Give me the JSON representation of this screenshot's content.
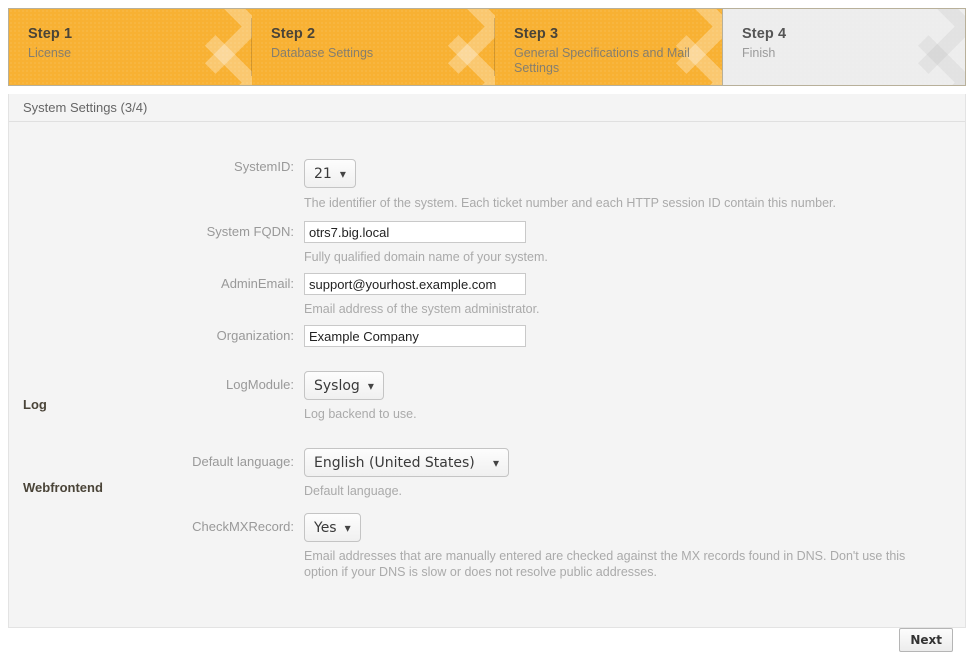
{
  "wizard": {
    "steps": [
      {
        "title": "Step 1",
        "subtitle": "License",
        "state": "done"
      },
      {
        "title": "Step 2",
        "subtitle": "Database Settings",
        "state": "done"
      },
      {
        "title": "Step 3",
        "subtitle": "General Specifications and Mail Settings",
        "state": "active"
      },
      {
        "title": "Step 4",
        "subtitle": "Finish",
        "state": "inactive"
      }
    ],
    "active_color": "#f8b133",
    "inactive_color": "#ededed"
  },
  "panel": {
    "header": "System Settings (3/4)"
  },
  "sections": {
    "log": "Log",
    "webfrontend": "Webfrontend"
  },
  "fields": {
    "system_id": {
      "label": "SystemID:",
      "value": "21",
      "hint": "The identifier of the system. Each ticket number and each HTTP session ID contain this number."
    },
    "system_fqdn": {
      "label": "System FQDN:",
      "value": "otrs7.big.local",
      "hint": "Fully qualified domain name of your system."
    },
    "admin_email": {
      "label": "AdminEmail:",
      "value": "support@yourhost.example.com",
      "hint": "Email address of the system administrator."
    },
    "organization": {
      "label": "Organization:",
      "value": "Example Company",
      "hint": ""
    },
    "log_module": {
      "label": "LogModule:",
      "value": "Syslog",
      "hint": "Log backend to use."
    },
    "default_language": {
      "label": "Default language:",
      "value": "English (United States)",
      "hint": "Default language."
    },
    "check_mx_record": {
      "label": "CheckMXRecord:",
      "value": "Yes",
      "hint": "Email addresses that are manually entered are checked against the MX records found in DNS. Don't use this option if your DNS is slow or does not resolve public addresses."
    }
  },
  "icons": {
    "caret": "⌄",
    "chevron_down": "chevron-down-icon"
  },
  "footer": {
    "next_label": "Next"
  }
}
